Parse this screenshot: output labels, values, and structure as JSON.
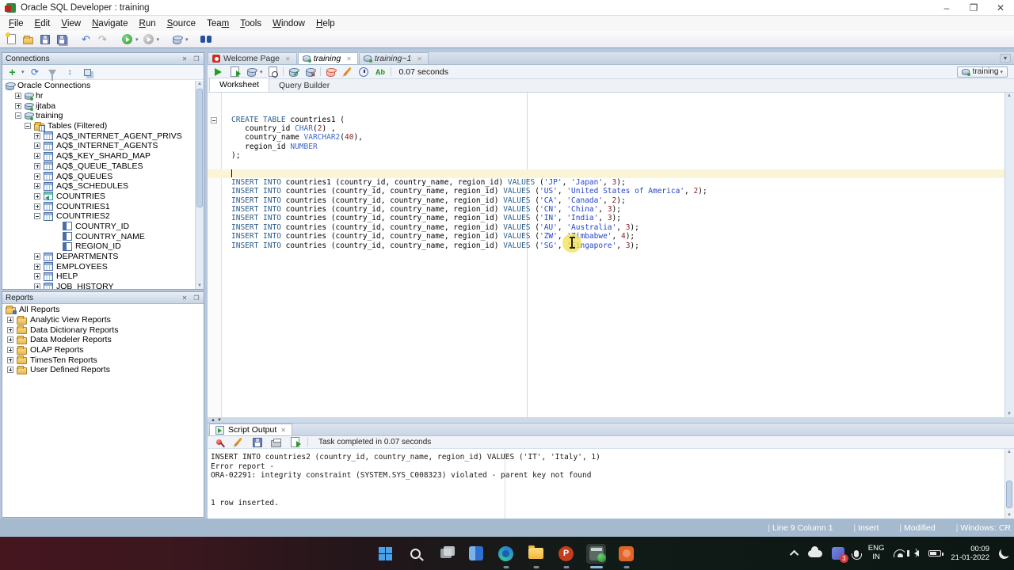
{
  "window": {
    "title": "Oracle SQL Developer : training",
    "minimize": "–",
    "maximize": "❐",
    "close": "✕"
  },
  "menu": {
    "items": [
      {
        "label": "File",
        "ul": 0
      },
      {
        "label": "Edit",
        "ul": 0
      },
      {
        "label": "View",
        "ul": 0
      },
      {
        "label": "Navigate",
        "ul": 0
      },
      {
        "label": "Run",
        "ul": 0
      },
      {
        "label": "Source",
        "ul": 0
      },
      {
        "label": "Team",
        "ul": 3
      },
      {
        "label": "Tools",
        "ul": 0
      },
      {
        "label": "Window",
        "ul": 0
      },
      {
        "label": "Help",
        "ul": 0
      }
    ]
  },
  "connections_panel": {
    "title": "Connections",
    "tree": [
      {
        "label": "Oracle Connections",
        "pad": 4,
        "exp": null,
        "icon": "db"
      },
      {
        "label": "hr",
        "pad": 16,
        "exp": "plus",
        "icon": "conn"
      },
      {
        "label": "ijtaba",
        "pad": 16,
        "exp": "plus",
        "icon": "conn"
      },
      {
        "label": "training",
        "pad": 16,
        "exp": "minus",
        "icon": "conn"
      },
      {
        "label": "Tables (Filtered)",
        "pad": 28,
        "exp": "minus",
        "icon": "folder-tbl"
      },
      {
        "label": "AQ$_INTERNET_AGENT_PRIVS",
        "pad": 40,
        "exp": "plus",
        "icon": "table"
      },
      {
        "label": "AQ$_INTERNET_AGENTS",
        "pad": 40,
        "exp": "plus",
        "icon": "table"
      },
      {
        "label": "AQ$_KEY_SHARD_MAP",
        "pad": 40,
        "exp": "plus",
        "icon": "table"
      },
      {
        "label": "AQ$_QUEUE_TABLES",
        "pad": 40,
        "exp": "plus",
        "icon": "table"
      },
      {
        "label": "AQ$_QUEUES",
        "pad": 40,
        "exp": "plus",
        "icon": "table"
      },
      {
        "label": "AQ$_SCHEDULES",
        "pad": 40,
        "exp": "plus",
        "icon": "table"
      },
      {
        "label": "COUNTRIES",
        "pad": 40,
        "exp": "plus",
        "icon": "view"
      },
      {
        "label": "COUNTRIES1",
        "pad": 40,
        "exp": "plus",
        "icon": "table"
      },
      {
        "label": "COUNTRIES2",
        "pad": 40,
        "exp": "minus",
        "icon": "table"
      },
      {
        "label": "COUNTRY_ID",
        "pad": 64,
        "exp": null,
        "icon": "col"
      },
      {
        "label": "COUNTRY_NAME",
        "pad": 64,
        "exp": null,
        "icon": "col"
      },
      {
        "label": "REGION_ID",
        "pad": 64,
        "exp": null,
        "icon": "col"
      },
      {
        "label": "DEPARTMENTS",
        "pad": 40,
        "exp": "plus",
        "icon": "table"
      },
      {
        "label": "EMPLOYEES",
        "pad": 40,
        "exp": "plus",
        "icon": "table"
      },
      {
        "label": "HELP",
        "pad": 40,
        "exp": "plus",
        "icon": "table"
      },
      {
        "label": "JOB_HISTORY",
        "pad": 40,
        "exp": "plus",
        "icon": "table"
      }
    ]
  },
  "reports_panel": {
    "title": "Reports",
    "tree": [
      {
        "label": "All Reports",
        "pad": 4,
        "exp": null,
        "icon": "rfolder"
      },
      {
        "label": "Analytic View Reports",
        "pad": 6,
        "exp": "plus",
        "icon": "folder"
      },
      {
        "label": "Data Dictionary Reports",
        "pad": 6,
        "exp": "plus",
        "icon": "folder"
      },
      {
        "label": "Data Modeler Reports",
        "pad": 6,
        "exp": "plus",
        "icon": "folder"
      },
      {
        "label": "OLAP Reports",
        "pad": 6,
        "exp": "plus",
        "icon": "folder"
      },
      {
        "label": "TimesTen Reports",
        "pad": 6,
        "exp": "plus",
        "icon": "folder"
      },
      {
        "label": "User Defined Reports",
        "pad": 6,
        "exp": "plus",
        "icon": "folder"
      }
    ]
  },
  "editor_tabs": [
    {
      "label": "Welcome Page",
      "icon": "oracle",
      "active": false,
      "italic": false
    },
    {
      "label": "training",
      "icon": "conn",
      "active": true,
      "italic": true
    },
    {
      "label": "training~1",
      "icon": "conn",
      "active": false,
      "italic": true
    }
  ],
  "worksheet": {
    "elapsed": "0.07 seconds",
    "connection_selector": "training",
    "subtabs": [
      {
        "label": "Worksheet",
        "active": true
      },
      {
        "label": "Query Builder",
        "active": false
      }
    ]
  },
  "editor": {
    "cursor_line": 8,
    "lines": [
      [],
      [],
      [
        {
          "t": "CREATE TABLE",
          "c": "k"
        },
        {
          "t": " countries1 (",
          "c": "p"
        }
      ],
      [
        {
          "t": "   country_id ",
          "c": "p"
        },
        {
          "t": "CHAR",
          "c": "d"
        },
        {
          "t": "(",
          "c": "p"
        },
        {
          "t": "2",
          "c": "n"
        },
        {
          "t": ") ,",
          "c": "p"
        }
      ],
      [
        {
          "t": "   country_name ",
          "c": "p"
        },
        {
          "t": "VARCHAR2",
          "c": "d"
        },
        {
          "t": "(",
          "c": "p"
        },
        {
          "t": "40",
          "c": "n"
        },
        {
          "t": "),",
          "c": "p"
        }
      ],
      [
        {
          "t": "   region_id ",
          "c": "p"
        },
        {
          "t": "NUMBER",
          "c": "d"
        }
      ],
      [
        {
          "t": ");",
          "c": "p"
        }
      ],
      [],
      [],
      [
        {
          "t": "INSERT INTO",
          "c": "k"
        },
        {
          "t": " countries1 (country_id, country_name, region_id) ",
          "c": "p"
        },
        {
          "t": "VALUES",
          "c": "k"
        },
        {
          "t": " (",
          "c": "p"
        },
        {
          "t": "'JP'",
          "c": "s"
        },
        {
          "t": ", ",
          "c": "p"
        },
        {
          "t": "'Japan'",
          "c": "s"
        },
        {
          "t": ", ",
          "c": "p"
        },
        {
          "t": "3",
          "c": "n"
        },
        {
          "t": ");",
          "c": "p"
        }
      ],
      [
        {
          "t": "INSERT INTO",
          "c": "k"
        },
        {
          "t": " countries (country_id, country_name, region_id) ",
          "c": "p"
        },
        {
          "t": "VALUES",
          "c": "k"
        },
        {
          "t": " (",
          "c": "p"
        },
        {
          "t": "'US'",
          "c": "s"
        },
        {
          "t": ", ",
          "c": "p"
        },
        {
          "t": "'United States of America'",
          "c": "s"
        },
        {
          "t": ", ",
          "c": "p"
        },
        {
          "t": "2",
          "c": "n"
        },
        {
          "t": ");",
          "c": "p"
        }
      ],
      [
        {
          "t": "INSERT INTO",
          "c": "k"
        },
        {
          "t": " countries (country_id, country_name, region_id) ",
          "c": "p"
        },
        {
          "t": "VALUES",
          "c": "k"
        },
        {
          "t": " (",
          "c": "p"
        },
        {
          "t": "'CA'",
          "c": "s"
        },
        {
          "t": ", ",
          "c": "p"
        },
        {
          "t": "'Canada'",
          "c": "s"
        },
        {
          "t": ", ",
          "c": "p"
        },
        {
          "t": "2",
          "c": "n"
        },
        {
          "t": ");",
          "c": "p"
        }
      ],
      [
        {
          "t": "INSERT INTO",
          "c": "k"
        },
        {
          "t": " countries (country_id, country_name, region_id) ",
          "c": "p"
        },
        {
          "t": "VALUES",
          "c": "k"
        },
        {
          "t": " (",
          "c": "p"
        },
        {
          "t": "'CN'",
          "c": "s"
        },
        {
          "t": ", ",
          "c": "p"
        },
        {
          "t": "'China'",
          "c": "s"
        },
        {
          "t": ", ",
          "c": "p"
        },
        {
          "t": "3",
          "c": "n"
        },
        {
          "t": ");",
          "c": "p"
        }
      ],
      [
        {
          "t": "INSERT INTO",
          "c": "k"
        },
        {
          "t": " countries (country_id, country_name, region_id) ",
          "c": "p"
        },
        {
          "t": "VALUES",
          "c": "k"
        },
        {
          "t": " (",
          "c": "p"
        },
        {
          "t": "'IN'",
          "c": "s"
        },
        {
          "t": ", ",
          "c": "p"
        },
        {
          "t": "'India'",
          "c": "s"
        },
        {
          "t": ", ",
          "c": "p"
        },
        {
          "t": "3",
          "c": "n"
        },
        {
          "t": ");",
          "c": "p"
        }
      ],
      [
        {
          "t": "INSERT INTO",
          "c": "k"
        },
        {
          "t": " countries (country_id, country_name, region_id) ",
          "c": "p"
        },
        {
          "t": "VALUES",
          "c": "k"
        },
        {
          "t": " (",
          "c": "p"
        },
        {
          "t": "'AU'",
          "c": "s"
        },
        {
          "t": ", ",
          "c": "p"
        },
        {
          "t": "'Australia'",
          "c": "s"
        },
        {
          "t": ", ",
          "c": "p"
        },
        {
          "t": "3",
          "c": "n"
        },
        {
          "t": ");",
          "c": "p"
        }
      ],
      [
        {
          "t": "INSERT INTO",
          "c": "k"
        },
        {
          "t": " countries (country_id, country_name, region_id) ",
          "c": "p"
        },
        {
          "t": "VALUES",
          "c": "k"
        },
        {
          "t": " (",
          "c": "p"
        },
        {
          "t": "'ZW'",
          "c": "s"
        },
        {
          "t": ", ",
          "c": "p"
        },
        {
          "t": "'Zimbabwe'",
          "c": "s"
        },
        {
          "t": ", ",
          "c": "p"
        },
        {
          "t": "4",
          "c": "n"
        },
        {
          "t": ");",
          "c": "p"
        }
      ],
      [
        {
          "t": "INSERT INTO",
          "c": "k"
        },
        {
          "t": " countries (country_id, country_name, region_id) ",
          "c": "p"
        },
        {
          "t": "VALUES",
          "c": "k"
        },
        {
          "t": " (",
          "c": "p"
        },
        {
          "t": "'SG'",
          "c": "s"
        },
        {
          "t": ", ",
          "c": "p"
        },
        {
          "t": "'Singapore'",
          "c": "s"
        },
        {
          "t": ", ",
          "c": "p"
        },
        {
          "t": "3",
          "c": "n"
        },
        {
          "t": ");",
          "c": "p"
        }
      ]
    ]
  },
  "output_panel": {
    "tab": "Script Output",
    "status": "Task completed in 0.07 seconds",
    "lines": [
      "INSERT INTO countries2 (country_id, country_name, region_id) VALUES ('IT', 'Italy', 1)",
      "Error report -",
      "ORA-02291: integrity constraint (SYSTEM.SYS_C008323) violated - parent key not found",
      "",
      "",
      "1 row inserted."
    ]
  },
  "status_bar": {
    "items": [
      "Line 9 Column 1",
      "Insert",
      "Modified",
      "Windows: CR"
    ]
  },
  "taskbar": {
    "apps": [
      {
        "name": "start",
        "running": false,
        "active": false
      },
      {
        "name": "search",
        "running": false,
        "active": false
      },
      {
        "name": "task-view",
        "running": false,
        "active": false
      },
      {
        "name": "blue-app",
        "running": false,
        "active": false
      },
      {
        "name": "edge",
        "running": true,
        "active": false
      },
      {
        "name": "file-explorer",
        "running": true,
        "active": false
      },
      {
        "name": "powerpoint",
        "running": true,
        "active": false
      },
      {
        "name": "sql-developer",
        "running": true,
        "active": true
      },
      {
        "name": "orange-app",
        "running": true,
        "active": false
      }
    ],
    "tray": {
      "teams_badge": "3",
      "lang_line1": "ENG",
      "lang_line2": "IN",
      "time": "00:09",
      "date": "21-01-2022",
      "ppt_letter": "P"
    }
  },
  "colors": {
    "accent": "#3aa03a",
    "keyword": "#2a5d8a",
    "string": "#2244cc",
    "number": "#8b1a1a",
    "statusbar": "#a6bacf"
  }
}
